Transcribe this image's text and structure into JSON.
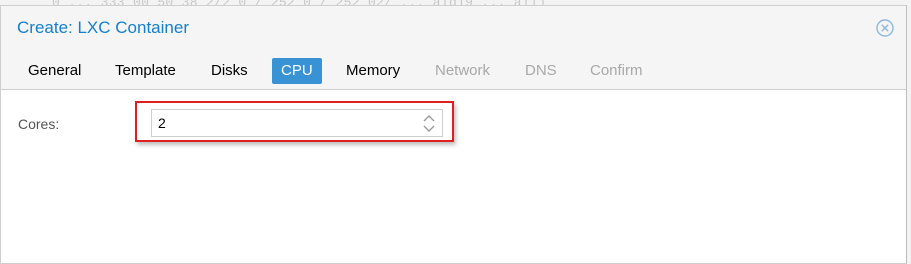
{
  "background": {
    "text": "0 ... 333 00 50 38 2/2 0 / 252 0 / 252 02/ ... ald19 ... ali)"
  },
  "dialog": {
    "title": "Create: LXC Container",
    "accent_color": "#157fcc",
    "close_icon": "close-circle-icon"
  },
  "tabs": [
    {
      "label": "General",
      "state": "enabled"
    },
    {
      "label": "Template",
      "state": "enabled"
    },
    {
      "label": "Disks",
      "state": "enabled"
    },
    {
      "label": "CPU",
      "state": "active"
    },
    {
      "label": "Memory",
      "state": "enabled"
    },
    {
      "label": "Network",
      "state": "disabled"
    },
    {
      "label": "DNS",
      "state": "disabled"
    },
    {
      "label": "Confirm",
      "state": "disabled"
    }
  ],
  "cpu_panel": {
    "cores_label": "Cores:",
    "cores_value": "2",
    "highlight_color": "#e02020"
  }
}
